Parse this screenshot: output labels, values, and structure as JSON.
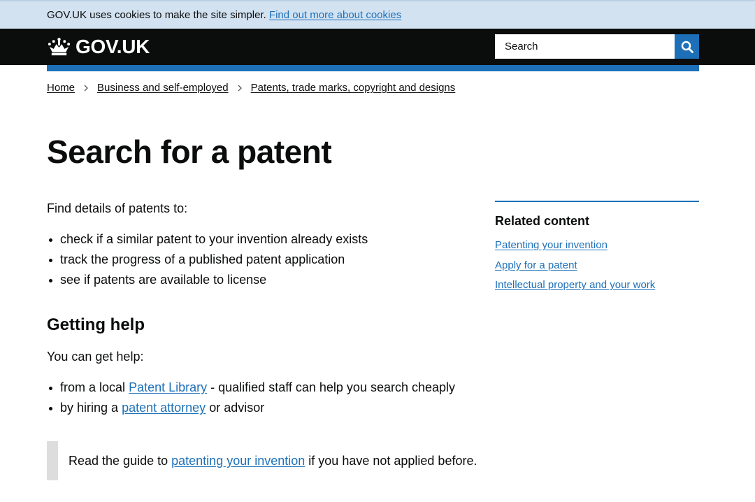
{
  "cookie_banner": {
    "text": "GOV.UK uses cookies to make the site simpler.",
    "link": "Find out more about cookies"
  },
  "header": {
    "logo_text": "GOV.UK",
    "search_placeholder": "Search",
    "brand_color": "#1d70b8"
  },
  "breadcrumb": [
    "Home",
    "Business and self-employed",
    "Patents, trade marks, copyright and designs"
  ],
  "title": "Search for a patent",
  "intro": "Find details of patents to:",
  "intro_bullets": [
    "check if a similar patent to your invention already exists",
    "track the progress of a published patent application",
    "see if patents are available to license"
  ],
  "help": {
    "heading": "Getting help",
    "text": "You can get help:",
    "bullet1": {
      "before": "from a local",
      "link": "Patent Library",
      "after": "- qualified staff can help you search cheaply"
    },
    "bullet2": {
      "before": "by hiring a",
      "link": "patent attorney",
      "after": "or advisor"
    }
  },
  "inset": {
    "before": "Read the guide to",
    "link": "patenting your invention",
    "after": "if you have not applied before."
  },
  "related": {
    "title": "Related content",
    "links": [
      "Patenting your invention",
      "Apply for a patent",
      "Intellectual property and your work"
    ]
  }
}
